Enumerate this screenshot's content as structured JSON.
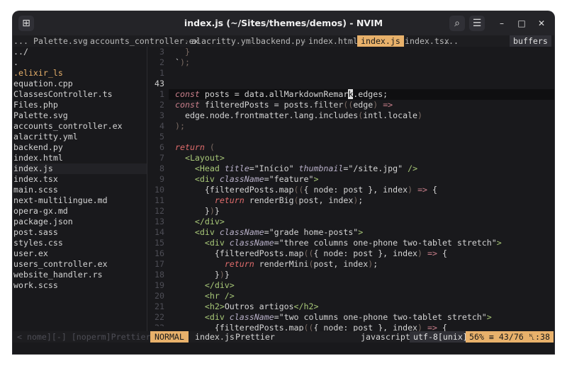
{
  "window": {
    "title": "index.js (~/Sites/themes/demos) - NVIM",
    "controls": {
      "minimize": "–",
      "maximize": "□",
      "close": "✕"
    }
  },
  "tabline": {
    "prefix": "...",
    "items": [
      "Palette.svg",
      "accounts_controller.ex",
      "alacritty.yml",
      "backend.py",
      "index.html",
      "index.js",
      "index.tsx",
      "..."
    ],
    "active": "index.js",
    "buffers_label": "buffers"
  },
  "tree": {
    "items": [
      "../",
      ".",
      ".elixir_ls",
      "equation.cpp",
      "ClassesController.ts",
      "Files.php",
      "Palette.svg",
      "accounts_controller.ex",
      "alacritty.yml",
      "backend.py",
      "index.html",
      "index.js",
      "index.tsx",
      "main.scss",
      "next-multilingue.md",
      "opera-gx.md",
      "package.json",
      "post.sass",
      "styles.css",
      "user.ex",
      "users_controller.ex",
      "website_handler.rs",
      "work.scss"
    ],
    "selected": "index.js",
    "footer": "< nome][-] [noperm]Prettier…"
  },
  "editor": {
    "line_numbers": [
      "3",
      "2",
      "1",
      "43",
      "1",
      "2",
      "3",
      "4",
      "5",
      "6",
      "7",
      "8",
      "9",
      "10",
      "11",
      "12",
      "13",
      "14",
      "15",
      "16",
      "17",
      "18",
      "19",
      "20",
      "21",
      "22",
      "23"
    ],
    "current_line": "43"
  },
  "statusbar": {
    "mode": "NORMAL",
    "file": "index.js",
    "formatter": "Prettier",
    "filetype": "javascript",
    "encoding": "utf-8[unix]",
    "position": "56% ≡ 43/76 ␤:38"
  },
  "colors": {
    "accent": "#e8b16b",
    "background": "#19191c",
    "keyword": "#c87e8a",
    "tag": "#a8c878"
  }
}
